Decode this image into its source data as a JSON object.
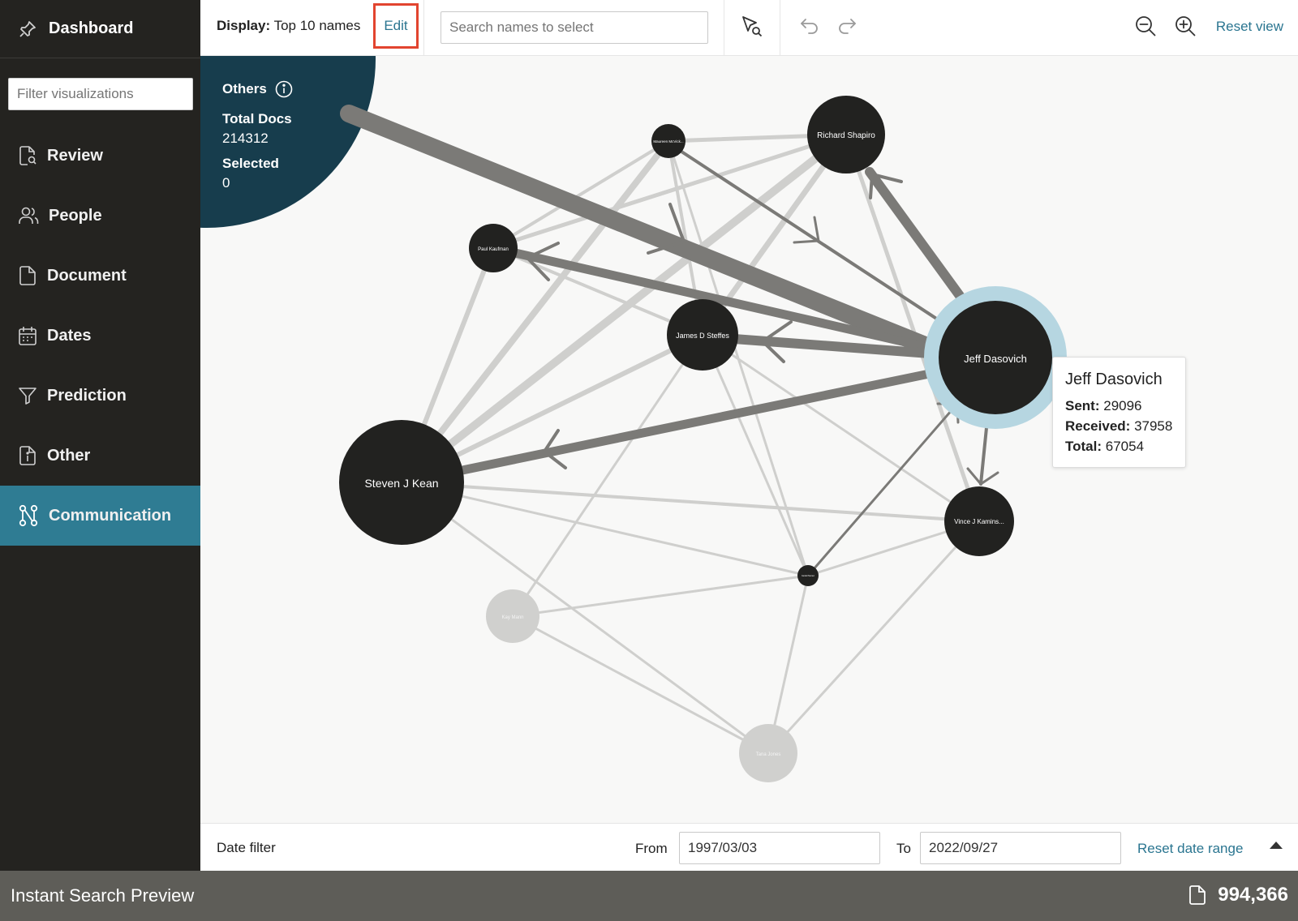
{
  "sidebar": {
    "title": "Dashboard",
    "filter_placeholder": "Filter visualizations",
    "items": [
      {
        "label": "Review"
      },
      {
        "label": "People"
      },
      {
        "label": "Document"
      },
      {
        "label": "Dates"
      },
      {
        "label": "Prediction"
      },
      {
        "label": "Other"
      },
      {
        "label": "Communication",
        "active": true
      }
    ]
  },
  "toolbar": {
    "display_label": "Display:",
    "display_value": "Top 10 names",
    "edit_label": "Edit",
    "search_placeholder": "Search names to select",
    "reset_view_label": "Reset view"
  },
  "others_panel": {
    "title": "Others",
    "total_docs_label": "Total Docs",
    "total_docs_value": "214312",
    "selected_label": "Selected",
    "selected_value": "0"
  },
  "graph": {
    "nodes": [
      {
        "id": "jeff",
        "name": "Jeff Dasovich",
        "selected": true
      },
      {
        "id": "richard",
        "name": "Richard Shapiro"
      },
      {
        "id": "maureen",
        "name": "Maureen McVick..."
      },
      {
        "id": "paul",
        "name": "Paul Kaufman"
      },
      {
        "id": "james",
        "name": "James D Steffes"
      },
      {
        "id": "steven",
        "name": "Steven J Kean"
      },
      {
        "id": "vince",
        "name": "Vince J Kamins..."
      },
      {
        "id": "small",
        "name": "Gerald Nemec"
      },
      {
        "id": "kay",
        "name": "Kay Mann",
        "faded": true
      },
      {
        "id": "tana",
        "name": "Tana Jones",
        "faded": true
      }
    ]
  },
  "tooltip": {
    "name": "Jeff Dasovich",
    "sent_label": "Sent:",
    "sent_value": "29096",
    "received_label": "Received:",
    "received_value": "37958",
    "total_label": "Total:",
    "total_value": "67054"
  },
  "date_filter": {
    "title": "Date filter",
    "from_label": "From",
    "from_value": "1997/03/03",
    "to_label": "To",
    "to_value": "2022/09/27",
    "reset_label": "Reset date range"
  },
  "footer": {
    "title": "Instant Search Preview",
    "count": "994,366"
  },
  "colors": {
    "sidebar_bg": "#242320",
    "active_bg": "#2f7c93",
    "link": "#2a7590",
    "others_bg": "#173d4d",
    "node": "#222220",
    "selection_ring": "#b6d6e1",
    "footer_bg": "#5e5d58"
  }
}
